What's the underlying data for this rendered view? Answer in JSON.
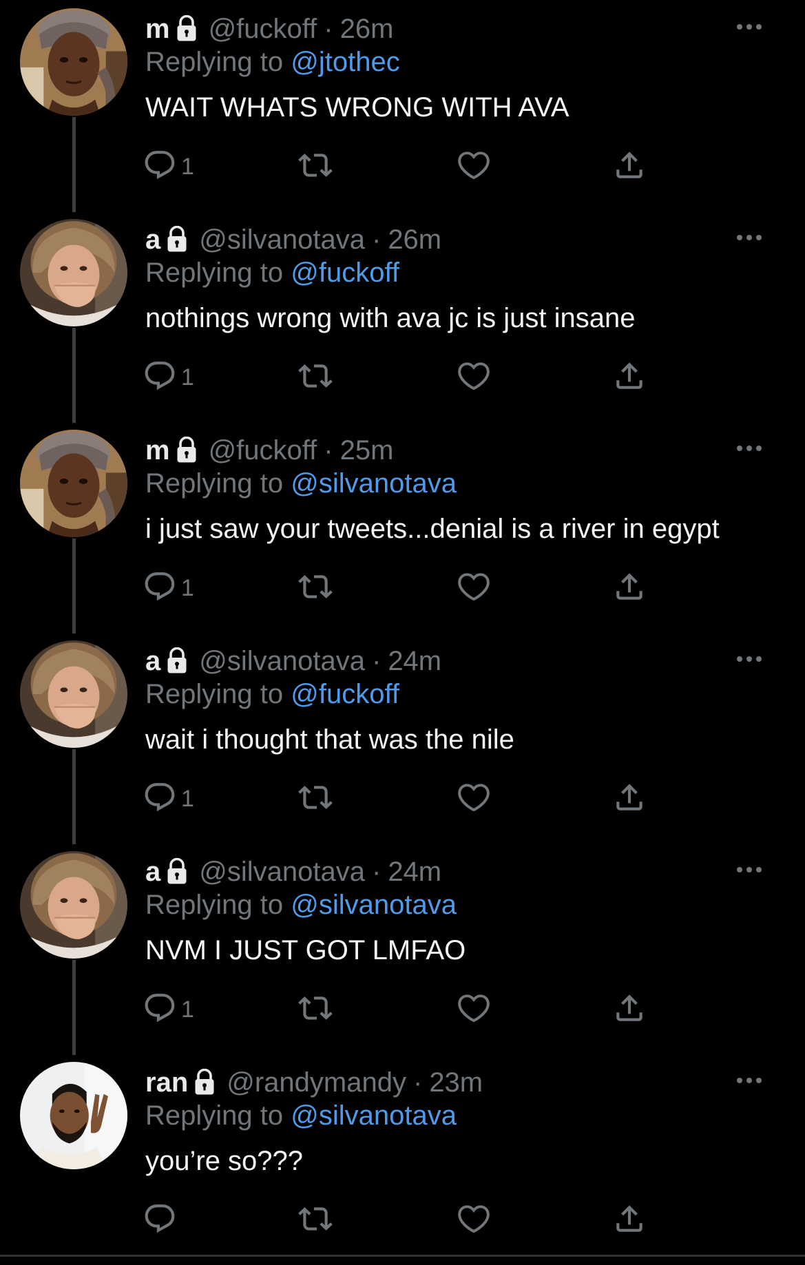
{
  "tweets": [
    {
      "name": "m",
      "handle": "@fuckoff",
      "sep": "·",
      "time": "26m",
      "replying_prefix": "Replying to",
      "replying_to": "@jtothec",
      "text": "WAIT WHATS WRONG WITH AVA",
      "reply_count": "1",
      "avatar": "woman-headscarf"
    },
    {
      "name": "a",
      "handle": "@silvanotava",
      "sep": "·",
      "time": "26m",
      "replying_prefix": "Replying to",
      "replying_to": "@fuckoff",
      "text": "nothings wrong with ava jc is just insane",
      "reply_count": "1",
      "avatar": "girl-hand-mouth"
    },
    {
      "name": "m",
      "handle": "@fuckoff",
      "sep": "·",
      "time": "25m",
      "replying_prefix": "Replying to",
      "replying_to": "@silvanotava",
      "text": "i just saw your tweets...denial is a river in egypt",
      "reply_count": "1",
      "avatar": "woman-headscarf"
    },
    {
      "name": "a",
      "handle": "@silvanotava",
      "sep": "·",
      "time": "24m",
      "replying_prefix": "Replying to",
      "replying_to": "@fuckoff",
      "text": "wait i thought that was the nile",
      "reply_count": "1",
      "avatar": "girl-hand-mouth"
    },
    {
      "name": "a",
      "handle": "@silvanotava",
      "sep": "·",
      "time": "24m",
      "replying_prefix": "Replying to",
      "replying_to": "@silvanotava",
      "text": "NVM I JUST GOT LMFAO",
      "reply_count": "1",
      "avatar": "girl-hand-mouth"
    },
    {
      "name": "ran",
      "handle": "@randymandy",
      "sep": "·",
      "time": "23m",
      "replying_prefix": "Replying to",
      "replying_to": "@silvanotava",
      "text": "you’re so???",
      "reply_count": "",
      "avatar": "man-peace-sign"
    }
  ],
  "icons": {
    "lock": "lock-icon",
    "more": "more-options-icon",
    "reply": "reply-icon",
    "retweet": "retweet-icon",
    "like": "like-icon",
    "share": "share-icon"
  },
  "colors": {
    "background": "#000000",
    "text": "#e7e9ea",
    "muted": "#71767b",
    "link": "#4f9bea",
    "thread": "#3a3f44"
  }
}
